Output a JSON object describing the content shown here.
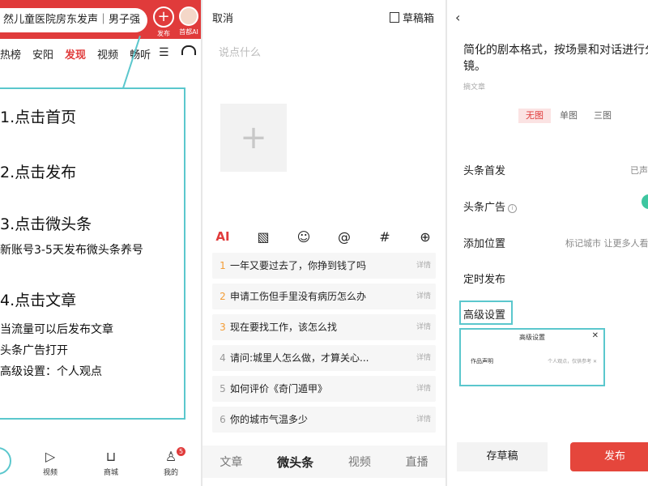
{
  "colors": {
    "brand_red": "#e03b3b",
    "highlight_teal": "#5bc7cd",
    "toggle_green": "#3ec6a0"
  },
  "panel1": {
    "search_text": "然儿童医院房东发声｜男子强",
    "publish_label": "发布",
    "avatar_label": "首都AI",
    "nav_tabs": [
      "热榜",
      "安阳",
      "发现",
      "视频",
      "畅听"
    ],
    "active_tab": "发现",
    "steps": [
      {
        "title": "1.点击首页",
        "notes": []
      },
      {
        "title": "2.点击发布",
        "notes": []
      },
      {
        "title": "3.点击微头条",
        "notes": [
          "新账号3-5天发布微头条养号"
        ]
      },
      {
        "title": "4.点击文章",
        "notes": [
          "当流量可以后发布文章",
          "头条广告打开",
          "高级设置：个人观点"
        ]
      }
    ],
    "bottom_nav": [
      {
        "icon": "play-icon",
        "label": "视频"
      },
      {
        "icon": "cart-icon",
        "label": "商城"
      },
      {
        "icon": "user-icon",
        "label": "我的"
      }
    ],
    "badge_count": "5"
  },
  "panel2": {
    "cancel_label": "取消",
    "drafts_label": "草稿箱",
    "placeholder": "说点什么",
    "toolbar_icons": [
      "ai-icon",
      "image-icon",
      "emoji-icon",
      "mention-icon",
      "hashtag-icon",
      "plus-circle-icon"
    ],
    "ai_label": "AI",
    "suggestions": [
      {
        "num": "1",
        "text": "一年又要过去了，你挣到钱了吗",
        "detail": "详情"
      },
      {
        "num": "2",
        "text": "申请工伤但手里没有病历怎么办",
        "detail": "详情"
      },
      {
        "num": "3",
        "text": "现在要找工作，该怎么找",
        "detail": "详情"
      },
      {
        "num": "4",
        "text": "请问:城里人怎么做，才算关心...",
        "detail": "详情"
      },
      {
        "num": "5",
        "text": "如何评价《奇门遁甲》",
        "detail": "详情"
      },
      {
        "num": "6",
        "text": "你的城市气温多少",
        "detail": "详情"
      }
    ],
    "bottom_tabs": [
      "文章",
      "微头条",
      "视频",
      "直播"
    ],
    "active_bottom_tab": "微头条"
  },
  "panel3": {
    "title": "简化的剧本格式，按场景和对话进行分镜。",
    "subtitle": "摘文章",
    "image_options": [
      "无图",
      "单图",
      "三图"
    ],
    "selected_image_option": "无图",
    "rows": {
      "first_publish": "头条首发",
      "first_publish_value": "已声",
      "ad": "头条广告",
      "location": "添加位置",
      "location_value": "标记城市 让更多人看",
      "scheduled": "定时发布",
      "advanced": "高级设置"
    },
    "popup": {
      "title": "高级设置",
      "label": "作品声明",
      "value": "个人观点，仅供参考 ✕"
    },
    "save_draft_label": "存草稿",
    "publish_label": "发布"
  }
}
